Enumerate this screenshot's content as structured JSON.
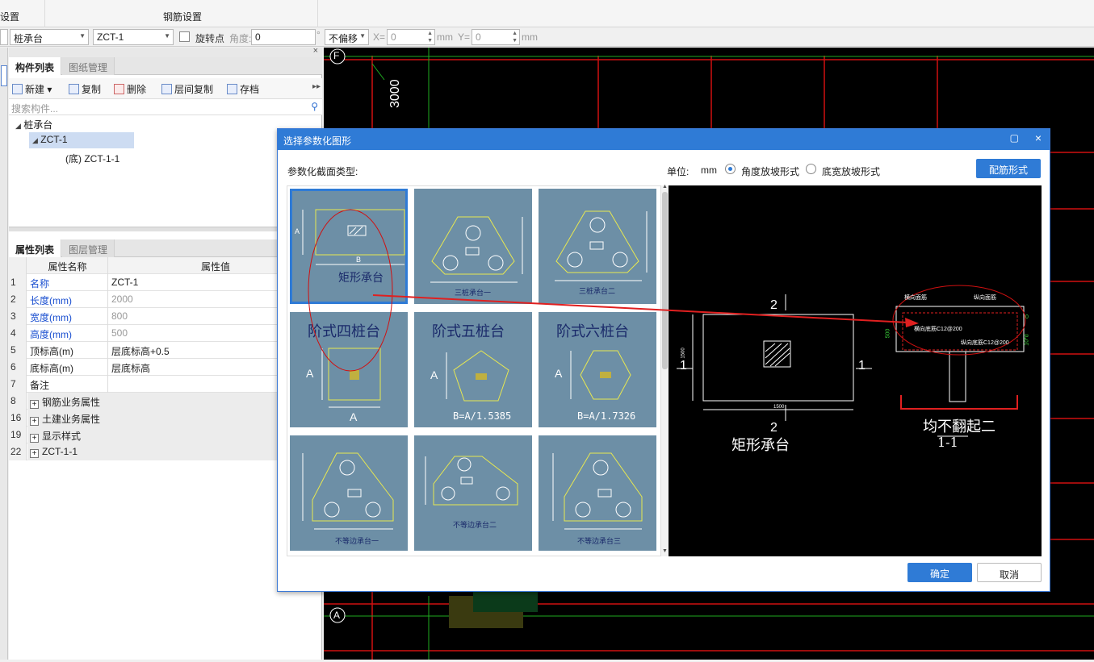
{
  "ribbon": {
    "left_label": "设置",
    "center_label": "钢筋设置"
  },
  "toolbar": {
    "type_combo": "桩承台",
    "component_combo": "ZCT-1",
    "rotate_label": "旋转点",
    "angle_label": "角度:",
    "angle_value": "0",
    "degree_unit": "°",
    "offset_combo": "不偏移",
    "x_label": "X=",
    "x_value": "0",
    "mm1": "mm",
    "y_label": "Y=",
    "y_value": "0",
    "mm2": "mm"
  },
  "component_panel": {
    "tabs": [
      "构件列表",
      "图纸管理"
    ],
    "buttons": {
      "new": "新建",
      "copy": "复制",
      "delete": "删除",
      "floor_copy": "层间复制",
      "save": "存档"
    },
    "search_placeholder": "搜索构件...",
    "tree": {
      "root": "桩承台",
      "child": "ZCT-1",
      "leaf": "(底) ZCT-1-1"
    }
  },
  "property_panel": {
    "tabs": [
      "属性列表",
      "图层管理"
    ],
    "headers": {
      "name": "属性名称",
      "value": "属性值"
    },
    "rows": [
      {
        "num": "1",
        "name": "名称",
        "value": "ZCT-1"
      },
      {
        "num": "2",
        "name": "长度(mm)",
        "value": "2000"
      },
      {
        "num": "3",
        "name": "宽度(mm)",
        "value": "800"
      },
      {
        "num": "4",
        "name": "高度(mm)",
        "value": "500"
      },
      {
        "num": "5",
        "name": "顶标高(m)",
        "value": "层底标高+0.5"
      },
      {
        "num": "6",
        "name": "底标高(m)",
        "value": "层底标高"
      },
      {
        "num": "7",
        "name": "备注",
        "value": ""
      },
      {
        "num": "8",
        "name": "钢筋业务属性",
        "value": ""
      },
      {
        "num": "16",
        "name": "土建业务属性",
        "value": ""
      },
      {
        "num": "19",
        "name": "显示样式",
        "value": ""
      },
      {
        "num": "22",
        "name": "ZCT-1-1",
        "value": ""
      }
    ]
  },
  "cad": {
    "axis_f": "F",
    "axis_a": "A",
    "dim_3000": "3000"
  },
  "dialog": {
    "title": "选择参数化图形",
    "section_label": "参数化截面类型:",
    "unit_label": "单位:",
    "unit_value": "mm",
    "radio_angle": "角度放坡形式",
    "radio_width": "底宽放坡形式",
    "rebar_button": "配筋形式",
    "ok": "确定",
    "cancel": "取消",
    "thumbs": {
      "t1": {
        "name": "矩形承台",
        "a": "A",
        "b": "B"
      },
      "t2": {
        "name": "三桩承台一"
      },
      "t3": {
        "name": "三桩承台二"
      },
      "t4": {
        "name": "阶式四桩台",
        "a": "A",
        "b": "A"
      },
      "t5": {
        "name": "阶式五桩台",
        "a": "A",
        "formula": "B=A/1.5385"
      },
      "t6": {
        "name": "阶式六桩台",
        "a": "A",
        "formula": "B=A/1.7326"
      },
      "t7": {
        "name": "不等边承台一"
      },
      "t8": {
        "name": "不等边承台二"
      },
      "t9": {
        "name": "不等边承台三"
      }
    },
    "preview": {
      "sec_top": "2",
      "sec_bottom": "2",
      "sec_left": "1",
      "sec_right": "1",
      "dim_h": "1500",
      "dim_w": "1500",
      "caption": "矩形承台",
      "cut_caption": "均不翻起二",
      "cut_label": "1-1",
      "top_h_bar": "横向面筋",
      "top_l_bar": "纵向面筋",
      "bot_h_bar": "横向底筋C12@200",
      "bot_l_bar": "纵向底筋C12@200",
      "side_dim": "500",
      "side_b": "0",
      "side_d": "10*d"
    }
  }
}
